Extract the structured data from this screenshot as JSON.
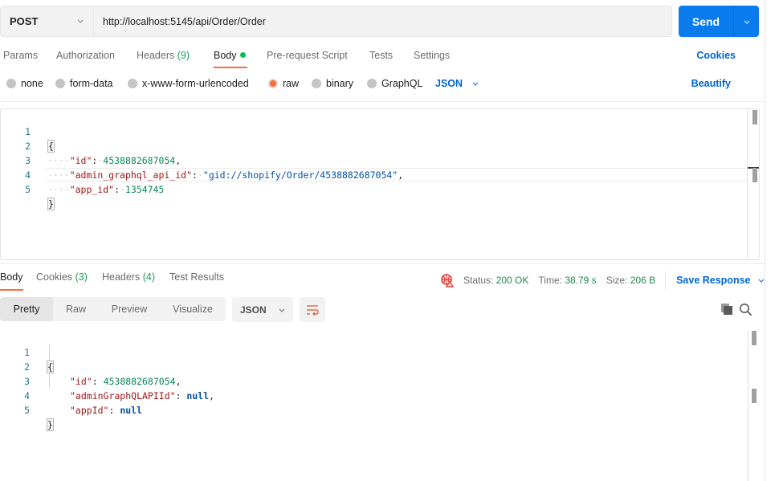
{
  "request": {
    "method": "POST",
    "url": "http://localhost:5145/api/Order/Order",
    "send_label": "Send"
  },
  "request_tabs": [
    {
      "label": "Params",
      "count": ""
    },
    {
      "label": "Authorization",
      "count": ""
    },
    {
      "label": "Headers",
      "count": "(9)"
    },
    {
      "label": "Body",
      "count": "",
      "active": true,
      "indicator": "green-dot"
    },
    {
      "label": "Pre-request Script",
      "count": ""
    },
    {
      "label": "Tests",
      "count": ""
    },
    {
      "label": "Settings",
      "count": ""
    }
  ],
  "cookies_label": "Cookies",
  "body_types": [
    {
      "label": "none",
      "checked": false
    },
    {
      "label": "form-data",
      "checked": false
    },
    {
      "label": "x-www-form-urlencoded",
      "checked": false
    },
    {
      "label": "raw",
      "checked": true
    },
    {
      "label": "binary",
      "checked": false
    },
    {
      "label": "GraphQL",
      "checked": false
    }
  ],
  "body_format": "JSON",
  "beautify_label": "Beautify",
  "request_body": {
    "line_numbers": [
      "1",
      "2",
      "3",
      "4",
      "5"
    ],
    "open_brace": "{",
    "close_brace": "}",
    "fields": [
      {
        "key": "\"id\"",
        "value": "4538882687054",
        "type": "number",
        "trail": ","
      },
      {
        "key": "\"admin_graphql_api_id\"",
        "value": "\"gid://shopify/Order/4538882687054\"",
        "type": "string",
        "trail": ","
      },
      {
        "key": "\"app_id\"",
        "value": "1354745",
        "type": "number",
        "trail": ""
      }
    ]
  },
  "response_tabs": [
    {
      "label": "Body",
      "count": "",
      "active": true
    },
    {
      "label": "Cookies",
      "count": "(3)"
    },
    {
      "label": "Headers",
      "count": "(4)"
    },
    {
      "label": "Test Results",
      "count": ""
    }
  ],
  "response_status": {
    "status_label": "Status:",
    "status_value": "200 OK",
    "time_label": "Time:",
    "time_value": "38.79 s",
    "size_label": "Size:",
    "size_value": "206 B",
    "save_label": "Save Response"
  },
  "response_views": [
    "Pretty",
    "Raw",
    "Preview",
    "Visualize"
  ],
  "response_active_view": "Pretty",
  "response_format": "JSON",
  "response_body": {
    "line_numbers": [
      "1",
      "2",
      "3",
      "4",
      "5"
    ],
    "open_brace": "{",
    "close_brace": "}",
    "fields": [
      {
        "key": "\"id\"",
        "value": "4538882687054",
        "type": "number",
        "trail": ","
      },
      {
        "key": "\"adminGraphQLAPIId\"",
        "value": "null",
        "type": "null",
        "trail": ","
      },
      {
        "key": "\"appId\"",
        "value": "null",
        "type": "null",
        "trail": ""
      }
    ]
  },
  "colors": {
    "accent_orange": "#ff6c37",
    "send_blue": "#097bed",
    "link_blue": "#0265d2",
    "success_green": "#1d8a4f",
    "json_key": "#a31515",
    "json_number": "#098658",
    "json_string": "#0451a5"
  }
}
